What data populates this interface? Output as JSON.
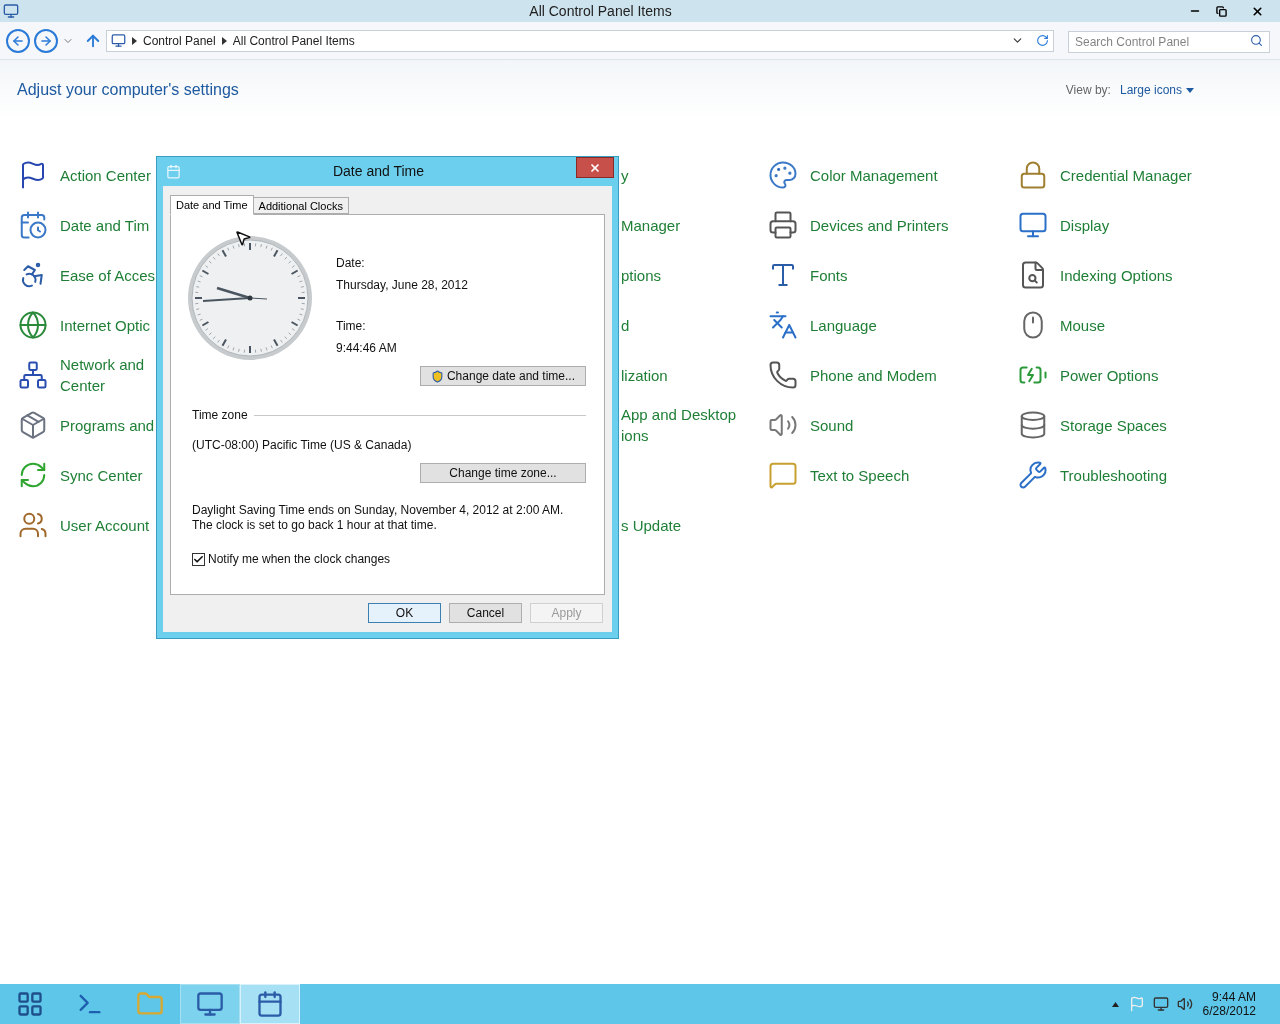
{
  "window": {
    "title": "All Control Panel Items"
  },
  "address_bar": {
    "breadcrumbs": [
      "Control Panel",
      "All Control Panel Items"
    ],
    "search": {
      "placeholder": "Search Control Panel"
    }
  },
  "heading": "Adjust your computer's settings",
  "view_by": {
    "label": "View by:",
    "value": "Large icons"
  },
  "rows": [
    {
      "left": [
        "Action Center"
      ],
      "middle": [
        "y"
      ],
      "third": [
        "Color Management"
      ],
      "fourth": [
        "Credential Manager"
      ]
    },
    {
      "left": [
        "Date and Tim"
      ],
      "middle": [
        "Manager"
      ],
      "third": [
        "Devices and Printers"
      ],
      "fourth": [
        "Display"
      ]
    },
    {
      "left": [
        "Ease of Acces"
      ],
      "middle": [
        "ptions"
      ],
      "third": [
        "Fonts"
      ],
      "fourth": [
        "Indexing Options"
      ]
    },
    {
      "left": [
        "Internet Optic"
      ],
      "middle": [
        "d"
      ],
      "third": [
        "Language"
      ],
      "fourth": [
        "Mouse"
      ]
    },
    {
      "left": [
        "Network and",
        "Center"
      ],
      "middle": [
        "lization"
      ],
      "third": [
        "Phone and Modem"
      ],
      "fourth": [
        "Power Options"
      ]
    },
    {
      "left": [
        "Programs and"
      ],
      "middle": [
        "App and Desktop",
        "ions"
      ],
      "third": [
        "Sound"
      ],
      "fourth": [
        "Storage Spaces"
      ]
    },
    {
      "left": [
        "Sync Center"
      ],
      "third": [
        "Text to Speech"
      ],
      "fourth": [
        "Troubleshooting"
      ]
    },
    {
      "left": [
        "User Account"
      ],
      "middle": [
        "s Update"
      ]
    }
  ],
  "dialog": {
    "title": "Date and Time",
    "tabs": [
      {
        "label": "Date and Time",
        "selected": true
      },
      {
        "label": "Additional Clocks",
        "selected": false
      }
    ],
    "date_label": "Date:",
    "date": "Thursday, June 28, 2012",
    "time_label": "Time:",
    "time": "9:44:46 AM",
    "change_datetime_button": "Change date and time...",
    "timezone_heading": "Time zone",
    "timezone": "(UTC-08:00) Pacific Time (US & Canada)",
    "change_timezone_button": "Change time zone...",
    "dst_note": "Daylight Saving Time ends on Sunday, November 4, 2012 at 2:00 AM. The clock is set to go back 1 hour at that time.",
    "notify": {
      "label": "Notify me when the clock changes",
      "checked": true
    },
    "buttons": [
      {
        "label": "OK",
        "disabled": false
      },
      {
        "label": "Cancel",
        "disabled": false
      },
      {
        "label": "Apply",
        "disabled": true
      }
    ]
  },
  "taskbar": {
    "apps": [
      {
        "open": false,
        "selected": false
      },
      {
        "open": false,
        "selected": false
      },
      {
        "open": false,
        "selected": false
      },
      {
        "open": true,
        "selected": false
      },
      {
        "open": true,
        "selected": true
      }
    ],
    "clock": {
      "time": "9:44 AM",
      "date": "6/28/2012"
    }
  }
}
